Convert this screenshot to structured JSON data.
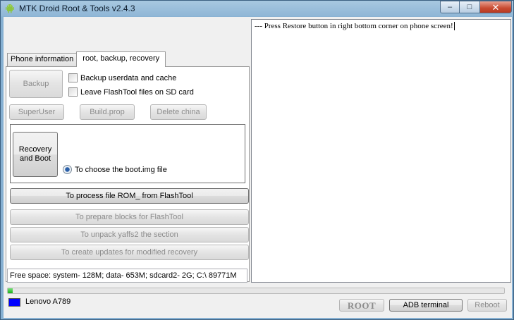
{
  "window": {
    "title": "MTK Droid Root & Tools v2.4.3",
    "controls": {
      "minimize": "–",
      "maximize": "□",
      "close": "✕"
    }
  },
  "tabs": [
    {
      "label": "Phone information",
      "active": false
    },
    {
      "label": "root, backup, recovery",
      "active": true
    }
  ],
  "panel": {
    "backup_button": "Backup",
    "backup_userdata_label": "Backup userdata and cache",
    "leave_flashtool_label": "Leave FlashTool files on SD card",
    "superuser_button": "SuperUser",
    "buildprop_button": "Build.prop",
    "delete_china_button": "Delete china",
    "recovery_boot_button": "Recovery and Boot",
    "choose_boot_label": "To choose the boot.img file",
    "process_rom_button": "To process file ROM_ from FlashTool",
    "prepare_blocks_button": "To prepare blocks for FlashTool",
    "unpack_yaffs2_button": "To unpack yaffs2 the section",
    "create_updates_button": "To create updates for modified recovery"
  },
  "status": {
    "free_space": "Free space: system- 128M; data- 653M; sdcard2- 2G;  C:\\ 89771M"
  },
  "log": {
    "text": "--- Press Restore button in right bottom corner on phone screen!"
  },
  "progress": {
    "value": 0.01
  },
  "device": {
    "name": "Lenovo A789",
    "color": "#0000ff"
  },
  "bottom_buttons": {
    "root": "ROOT",
    "adb_terminal": "ADB terminal",
    "reboot": "Reboot"
  },
  "icons": {
    "app": "android-icon"
  }
}
